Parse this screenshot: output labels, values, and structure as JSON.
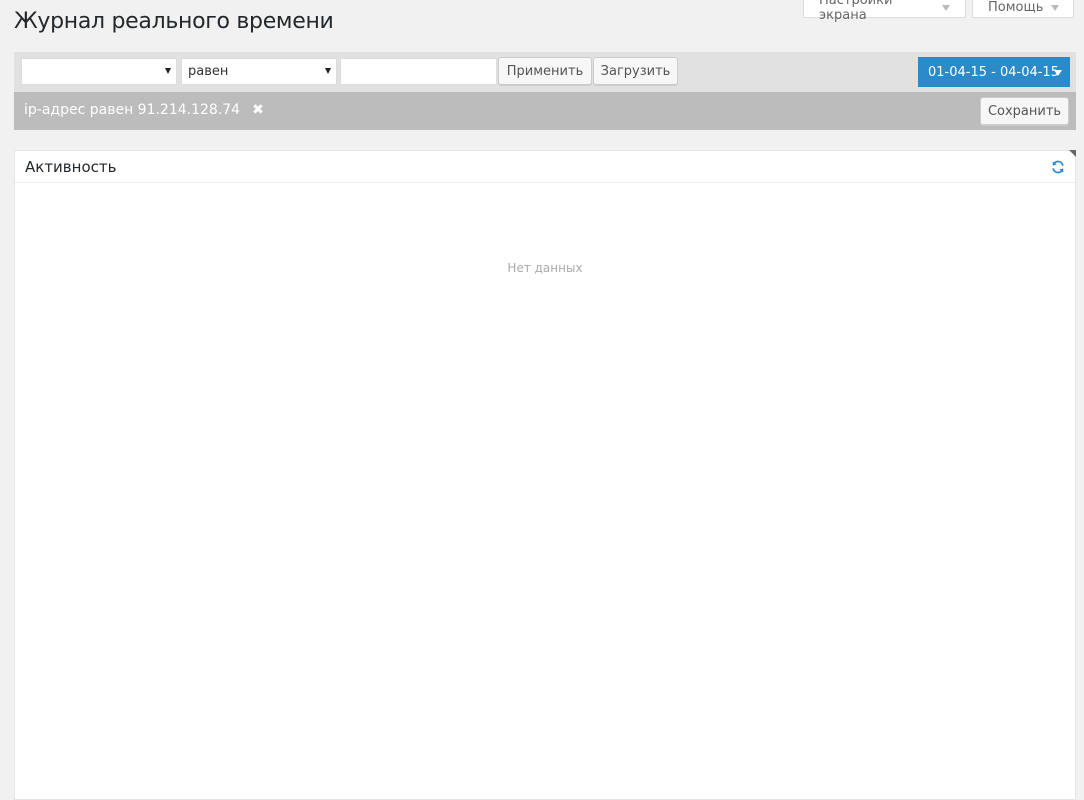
{
  "page": {
    "title": "Журнал реального времени"
  },
  "screen_meta": {
    "screen_options_label": "Настройки экрана",
    "help_label": "Помощь"
  },
  "filter_bar": {
    "field_select_value": "",
    "operator_select_value": "равен",
    "value_input_value": "",
    "apply_label": "Применить",
    "load_label": "Загрузить",
    "date_range_label": "01-04-15 - 04-04-15"
  },
  "active_filters": {
    "chip_label": "ip-адрес равен 91.214.128.74",
    "close_glyph": "✖",
    "save_label": "Сохранить"
  },
  "panel": {
    "title": "Активность",
    "empty_text": "Нет данных"
  },
  "colors": {
    "accent": "#2a8bc8",
    "filter_bar_bg": "#e1e1e1",
    "active_filter_bg": "#bcbcbc",
    "page_bg": "#f1f1f1"
  },
  "icons": {
    "refresh": "refresh-icon",
    "close": "close-icon",
    "dropdown": "chevron-down-icon"
  }
}
